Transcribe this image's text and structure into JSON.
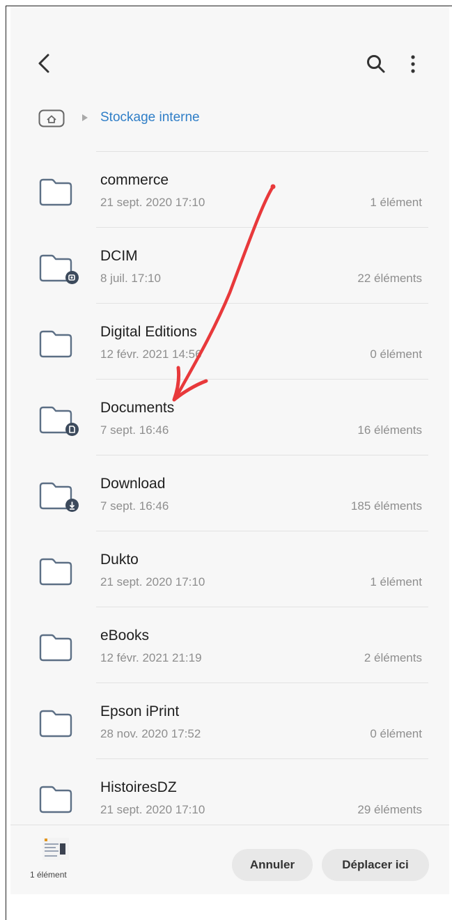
{
  "header": {
    "back_icon": "arrow-back-icon",
    "search_icon": "search-icon",
    "more_icon": "more-vertical-icon"
  },
  "breadcrumb": {
    "home_icon": "home-icon",
    "separator_icon": "triangle-right-icon",
    "current": "Stockage interne"
  },
  "folders": [
    {
      "name": "commerce",
      "date": "21 sept. 2020 17:10",
      "count": "1 élément",
      "badge": "none"
    },
    {
      "name": "DCIM",
      "date": "8 juil. 17:10",
      "count": "22 éléments",
      "badge": "camera"
    },
    {
      "name": "Digital Editions",
      "date": "12 févr. 2021 14:56",
      "count": "0 élément",
      "badge": "none"
    },
    {
      "name": "Documents",
      "date": "7 sept. 16:46",
      "count": "16 éléments",
      "badge": "document"
    },
    {
      "name": "Download",
      "date": "7 sept. 16:46",
      "count": "185 éléments",
      "badge": "download"
    },
    {
      "name": "Dukto",
      "date": "21 sept. 2020 17:10",
      "count": "1 élément",
      "badge": "none"
    },
    {
      "name": "eBooks",
      "date": "12 févr. 2021 21:19",
      "count": "2 éléments",
      "badge": "none"
    },
    {
      "name": "Epson iPrint",
      "date": "28 nov. 2020 17:52",
      "count": "0 élément",
      "badge": "none"
    },
    {
      "name": "HistoiresDZ",
      "date": "21 sept. 2020 17:10",
      "count": "29 éléments",
      "badge": "none"
    }
  ],
  "bottom": {
    "selection_caption": "1 élément",
    "cancel_label": "Annuler",
    "move_label": "Déplacer ici"
  },
  "colors": {
    "accent": "#2f7ec7",
    "annotation": "#e8393b",
    "folder_stroke": "#5c6f85",
    "background": "#f7f7f7"
  }
}
